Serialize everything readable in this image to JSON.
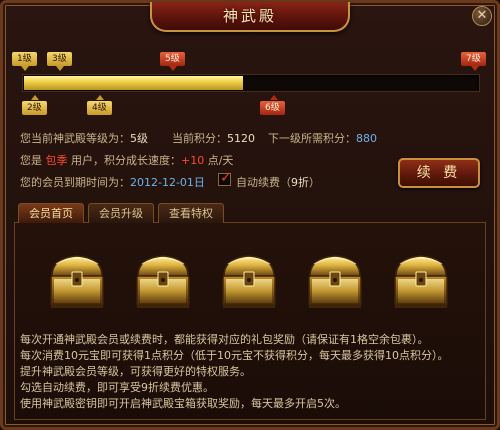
{
  "window": {
    "title": "神武殿",
    "close_glyph": "✕"
  },
  "levels": {
    "top_markers": [
      {
        "label": "1级",
        "style": "gold"
      },
      {
        "label": "3级",
        "style": "gold"
      },
      {
        "label": "5级",
        "style": "red"
      },
      {
        "label": "7级",
        "style": "red"
      }
    ],
    "bottom_markers": [
      {
        "label": "2级",
        "style": "gold"
      },
      {
        "label": "4级",
        "style": "gold"
      },
      {
        "label": "6级",
        "style": "red"
      }
    ],
    "progress_fraction": 0.48
  },
  "info": {
    "level_label": "您当前神武殿等级为：",
    "level_value": "5级",
    "points_label": "当前积分：",
    "points_value": "5120",
    "next_label": "下一级所需积分：",
    "next_value": "880",
    "user_prefix": "您是",
    "user_type": "包季",
    "user_suffix": "用户，积分成长速度：",
    "speed_value": "+10",
    "speed_unit": "点/天",
    "expiry_label": "您的会员到期时间为：",
    "expiry_value": "2012-12-01日",
    "auto_renew_label": "自动续费（",
    "auto_renew_discount": "9折",
    "auto_renew_suffix": "）",
    "auto_renew_checked": true
  },
  "buttons": {
    "renew_label": "续 费"
  },
  "tabs": [
    "会员首页",
    "会员升级",
    "查看特权"
  ],
  "chests": [
    {
      "icon": "treasure-chest-icon"
    },
    {
      "icon": "treasure-chest-icon"
    },
    {
      "icon": "treasure-chest-icon"
    },
    {
      "icon": "treasure-chest-icon"
    },
    {
      "icon": "treasure-chest-icon"
    }
  ],
  "description": [
    "每次开通神武殿会员或续费时，都能获得对应的礼包奖励（请保证有1格空余包裹）。",
    "每次消费10元宝即可获得1点积分（低于10元宝不获得积分，每天最多获得10点积分）。",
    "提升神武殿会员等级，可获得更好的特权服务。",
    "勾选自动续费，即可享受9折续费优惠。",
    "使用神武殿密钥即可开启神武殿宝箱获取奖励，每天最多开启5次。"
  ],
  "colors": {
    "accent_gold": "#f0d24a",
    "accent_red": "#ff4a2a",
    "value_blue": "#6fb3e6"
  }
}
